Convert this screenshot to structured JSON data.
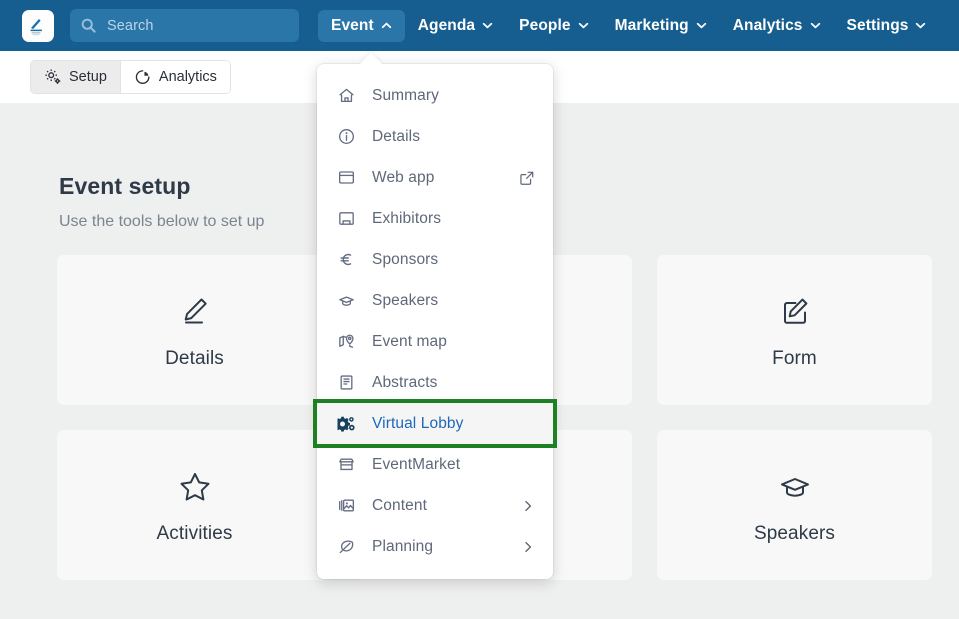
{
  "topbar": {
    "logo_name": "app-logo",
    "search": {
      "placeholder": "Search",
      "value": ""
    },
    "nav": [
      {
        "label": "Event",
        "icon": "chevron-up-icon",
        "active": true
      },
      {
        "label": "Agenda",
        "icon": "chevron-down-icon",
        "active": false
      },
      {
        "label": "People",
        "icon": "chevron-down-icon",
        "active": false
      },
      {
        "label": "Marketing",
        "icon": "chevron-down-icon",
        "active": false
      },
      {
        "label": "Analytics",
        "icon": "chevron-down-icon",
        "active": false
      },
      {
        "label": "Settings",
        "icon": "chevron-down-icon",
        "active": false
      }
    ]
  },
  "subbar": {
    "tabs": [
      {
        "label": "Setup",
        "icon": "gears-icon",
        "active": true
      },
      {
        "label": "Analytics",
        "icon": "pie-chart-icon",
        "active": false
      }
    ]
  },
  "main": {
    "title": "Event setup",
    "subtitle": "Use the tools below to set up",
    "cards": [
      {
        "label": "Details",
        "icon": "pencil-icon"
      },
      {
        "label": "",
        "icon": "hidden-icon"
      },
      {
        "label": "Form",
        "icon": "form-edit-icon"
      },
      {
        "label": "Activities",
        "icon": "star-icon"
      },
      {
        "label": "",
        "icon": "hidden-icon"
      },
      {
        "label": "Speakers",
        "icon": "graduation-cap-icon"
      }
    ]
  },
  "dropdown": {
    "items": [
      {
        "label": "Summary",
        "icon": "home-icon",
        "right": "",
        "highlighted": false
      },
      {
        "label": "Details",
        "icon": "info-circle-icon",
        "right": "",
        "highlighted": false
      },
      {
        "label": "Web app",
        "icon": "window-icon",
        "right": "external-link-icon",
        "highlighted": false
      },
      {
        "label": "Exhibitors",
        "icon": "booth-icon",
        "right": "",
        "highlighted": false
      },
      {
        "label": "Sponsors",
        "icon": "euro-icon",
        "right": "",
        "highlighted": false
      },
      {
        "label": "Speakers",
        "icon": "graduation-cap-icon",
        "right": "",
        "highlighted": false
      },
      {
        "label": "Event map",
        "icon": "map-pin-icon",
        "right": "",
        "highlighted": false
      },
      {
        "label": "Abstracts",
        "icon": "document-icon",
        "right": "",
        "highlighted": false
      },
      {
        "label": "Virtual Lobby",
        "icon": "gears-icon",
        "right": "",
        "highlighted": true
      },
      {
        "label": "EventMarket",
        "icon": "store-icon",
        "right": "",
        "highlighted": false
      },
      {
        "label": "Content",
        "icon": "images-icon",
        "right": "chevron-right-icon",
        "highlighted": false
      },
      {
        "label": "Planning",
        "icon": "leaf-icon",
        "right": "chevron-right-icon",
        "highlighted": false
      }
    ]
  },
  "colors": {
    "navbar_blue": "#175e90",
    "nav_active_blue": "#2a76a8",
    "page_bg": "#eeefef",
    "card_bg": "#f8f8f8",
    "highlight_green": "#1d8023",
    "highlight_link_blue": "#1d69b5",
    "menu_text": "#5f6879"
  }
}
